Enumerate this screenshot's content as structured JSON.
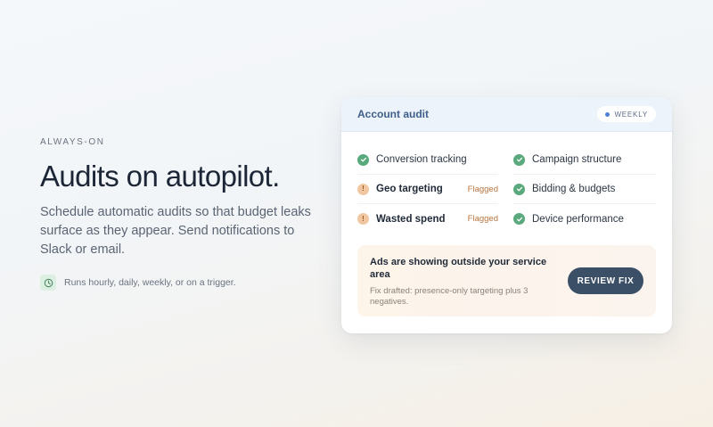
{
  "hero": {
    "eyebrow": "ALWAYS-ON",
    "headline": "Audits on autopilot.",
    "description": "Schedule automatic audits so that budget leaks surface as they appear. Send notifications to Slack or email.",
    "note": "Runs hourly, daily, weekly, or on a trigger.",
    "note_icon": "clock-icon"
  },
  "card": {
    "title": "Account audit",
    "badge": "WEEKLY",
    "left_checks": [
      {
        "label": "Conversion tracking",
        "status": "ok",
        "flag": ""
      },
      {
        "label": "Geo targeting",
        "status": "warn",
        "flag": "Flagged"
      },
      {
        "label": "Wasted spend",
        "status": "warn",
        "flag": "Flagged"
      }
    ],
    "right_checks": [
      {
        "label": "Campaign structure",
        "status": "ok"
      },
      {
        "label": "Bidding & budgets",
        "status": "ok"
      },
      {
        "label": "Device performance",
        "status": "ok"
      }
    ],
    "alert": {
      "title": "Ads are showing outside your service area",
      "subtitle": "Fix drafted: presence-only targeting plus 3 negatives.",
      "button": "REVIEW FIX"
    }
  },
  "colors": {
    "ok": "#5aa97d",
    "warn": "#f0c7a0",
    "accent": "#3b4f66",
    "header_title": "#3f5f8a"
  }
}
